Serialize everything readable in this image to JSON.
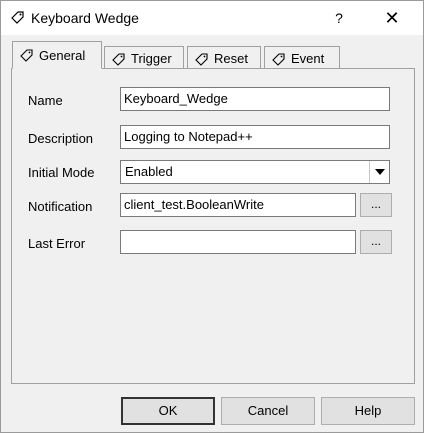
{
  "window": {
    "title": "Keyboard Wedge",
    "help_label": "?",
    "close_label": "✕"
  },
  "tabs": [
    {
      "label": "General",
      "active": true
    },
    {
      "label": "Trigger",
      "active": false
    },
    {
      "label": "Reset",
      "active": false
    },
    {
      "label": "Event",
      "active": false
    }
  ],
  "form": {
    "name": {
      "label": "Name",
      "value": "Keyboard_Wedge"
    },
    "description": {
      "label": "Description",
      "value": "Logging to Notepad++"
    },
    "initial_mode": {
      "label": "Initial Mode",
      "value": "Enabled"
    },
    "notification": {
      "label": "Notification",
      "value": "client_test.BooleanWrite",
      "browse_label": "..."
    },
    "last_error": {
      "label": "Last Error",
      "value": "",
      "browse_label": "..."
    }
  },
  "buttons": {
    "ok": "OK",
    "cancel": "Cancel",
    "help": "Help"
  },
  "icons": {
    "app": "tag-icon",
    "tab": "tag-icon"
  }
}
